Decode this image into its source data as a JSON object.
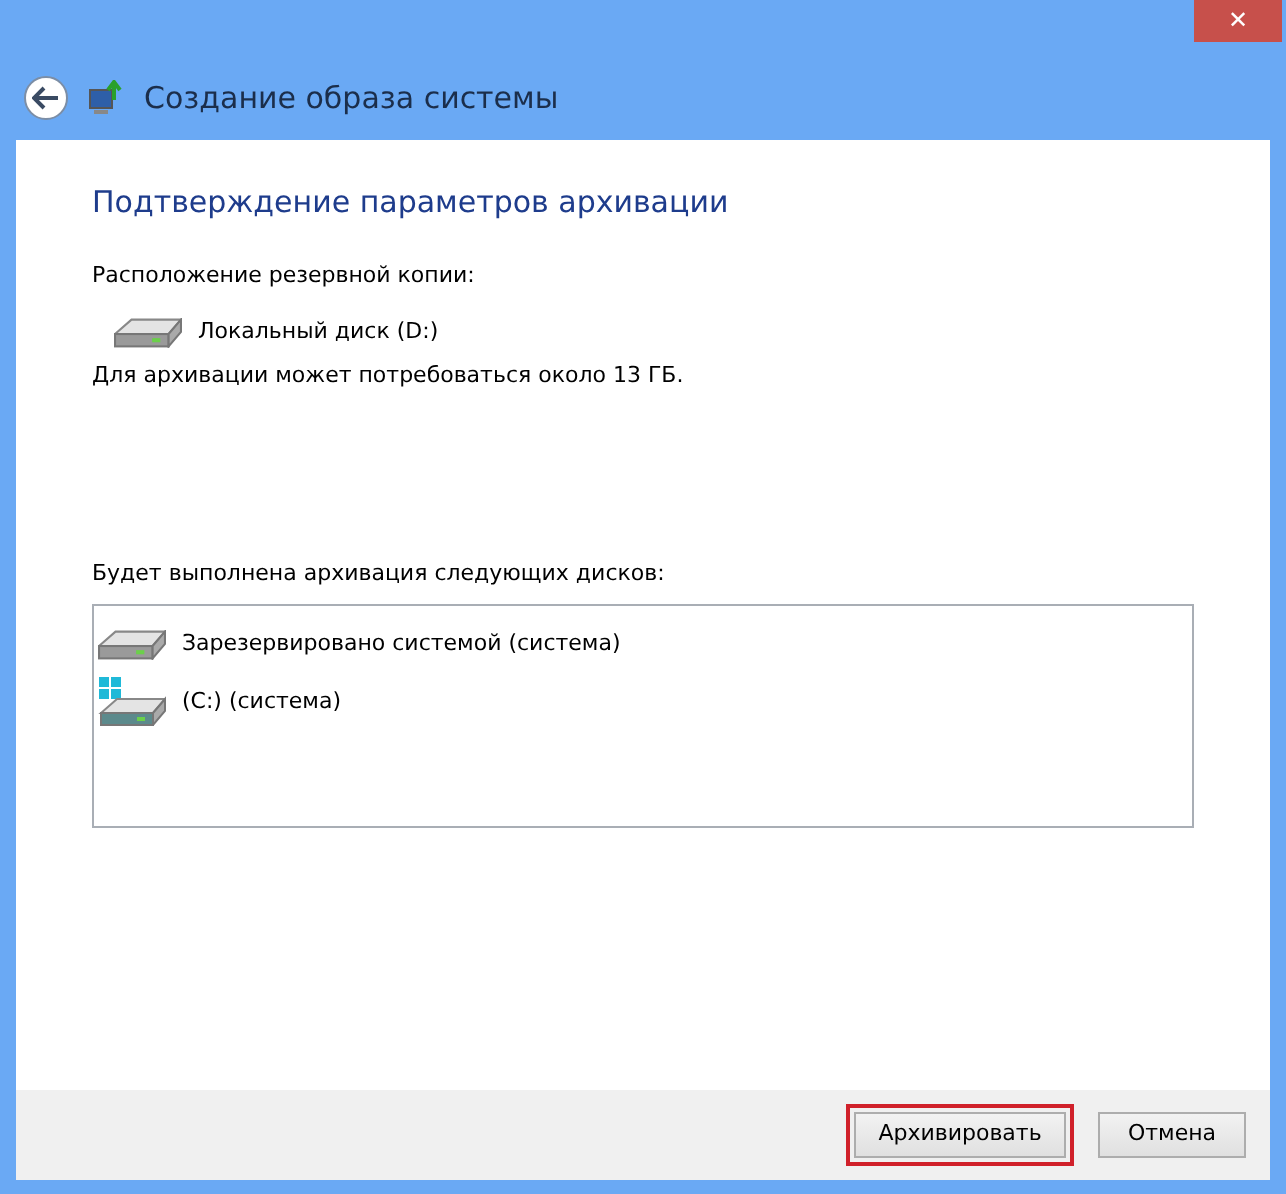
{
  "window": {
    "title": "Создание образа системы",
    "close_label": "✕"
  },
  "heading": "Подтверждение параметров архивации",
  "backup_location": {
    "label": "Расположение резервной копии:",
    "drive": "Локальный диск (D:)"
  },
  "note": "Для архивации может потребоваться около 13 ГБ.",
  "disks": {
    "label": "Будет выполнена архивация следующих дисков:",
    "items": [
      {
        "name": "Зарезервировано системой (система)",
        "kind": "drive"
      },
      {
        "name": "(C:) (система)",
        "kind": "system-drive"
      }
    ]
  },
  "buttons": [
    {
      "label": "Архивировать",
      "highlighted": true
    },
    {
      "label": "Отмена",
      "highlighted": false
    }
  ]
}
